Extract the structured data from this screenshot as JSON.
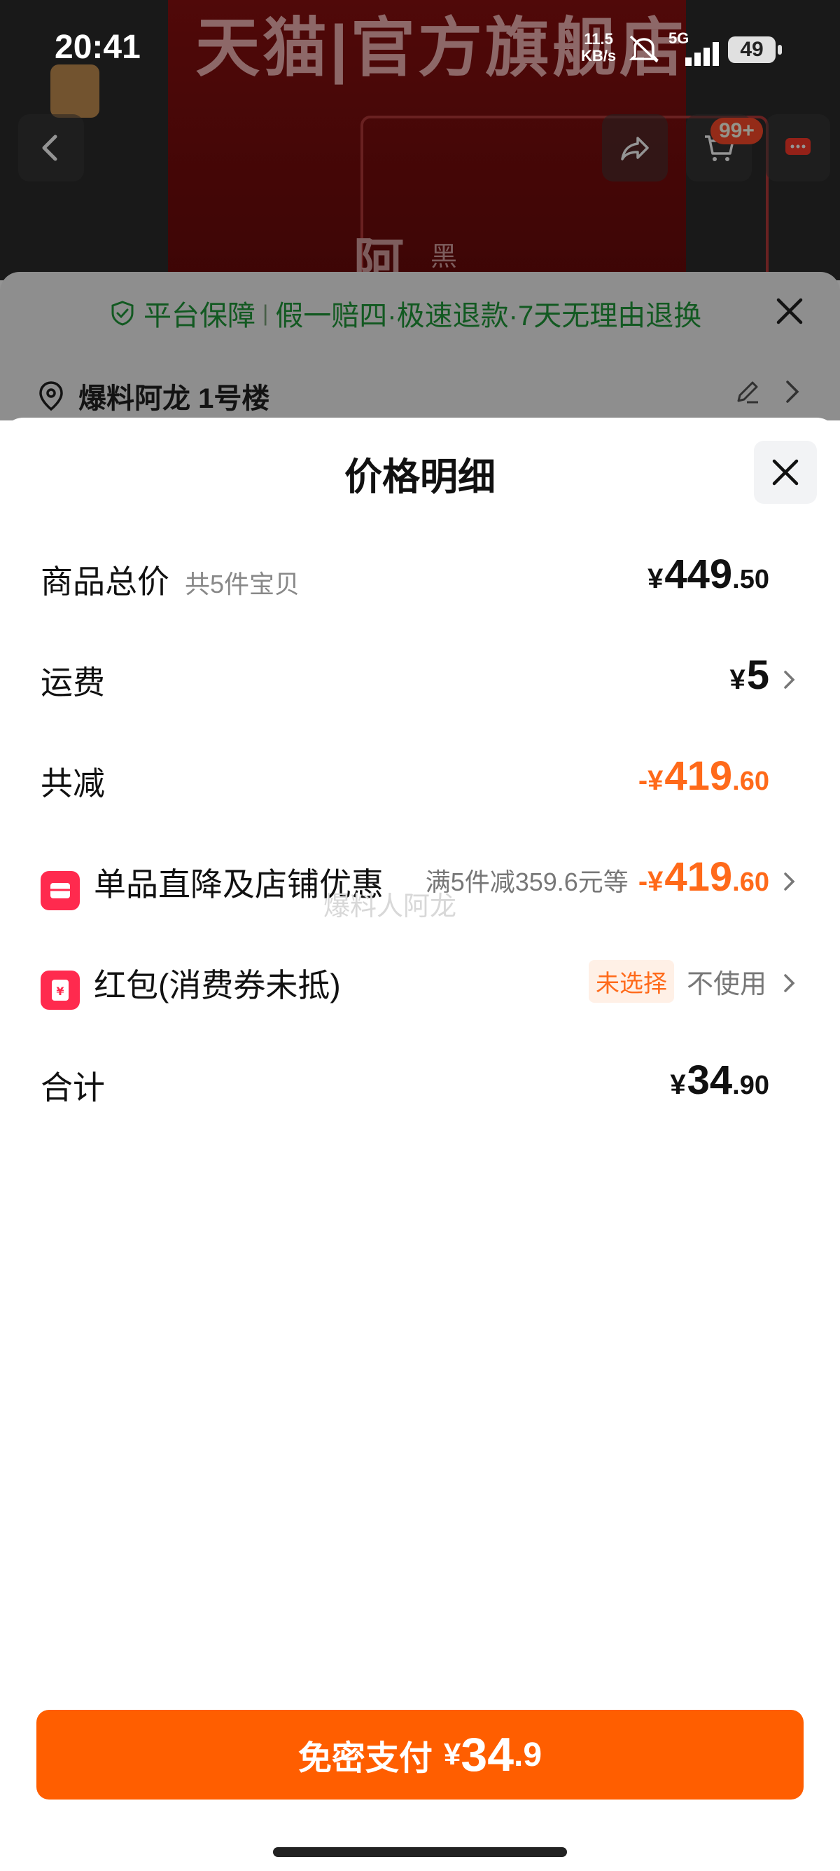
{
  "status_bar": {
    "time": "20:41",
    "net_speed_top": "11.5",
    "net_speed_bottom": "KB/s",
    "net_type": "5G",
    "battery": "49"
  },
  "background_page": {
    "hero_title": "天猫|官方旗舰店",
    "hero_char": "阿",
    "hero_char2": "黑",
    "cart_badge": "99+",
    "guarantee": {
      "platform": "平台保障",
      "items": "假一赔四·极速退款·7天无理由退换"
    },
    "address": "爆料阿龙 1号楼"
  },
  "sheet": {
    "title": "价格明细",
    "rows": {
      "total_goods": {
        "label": "商品总价",
        "sub": "共5件宝贝",
        "yen": "¥",
        "int": "449",
        "dec": ".50"
      },
      "shipping": {
        "label": "运费",
        "yen": "¥",
        "int": "5"
      },
      "total_reduce": {
        "label": "共减",
        "yen": "-¥",
        "int": "419",
        "dec": ".60"
      },
      "store_discount": {
        "label": "单品直降及店铺优惠",
        "desc": "满5件减359.6元等",
        "yen": "-¥",
        "int": "419",
        "dec": ".60"
      },
      "red_packet": {
        "label": "红包(消费券未抵)",
        "tag": "未选择",
        "value": "不使用"
      },
      "sum": {
        "label": "合计",
        "yen": "¥",
        "int": "34",
        "dec": ".90"
      }
    },
    "watermark": "爆料人阿龙"
  },
  "pay_button": {
    "label": "免密支付",
    "yen": "¥",
    "int": "34",
    "dec": ".9"
  },
  "colors": {
    "accent_orange": "#ff5e00",
    "discount_orange": "#ff6a1a",
    "guarantee_green": "#1f9a3a",
    "red_icon": "#ff2a4e"
  }
}
